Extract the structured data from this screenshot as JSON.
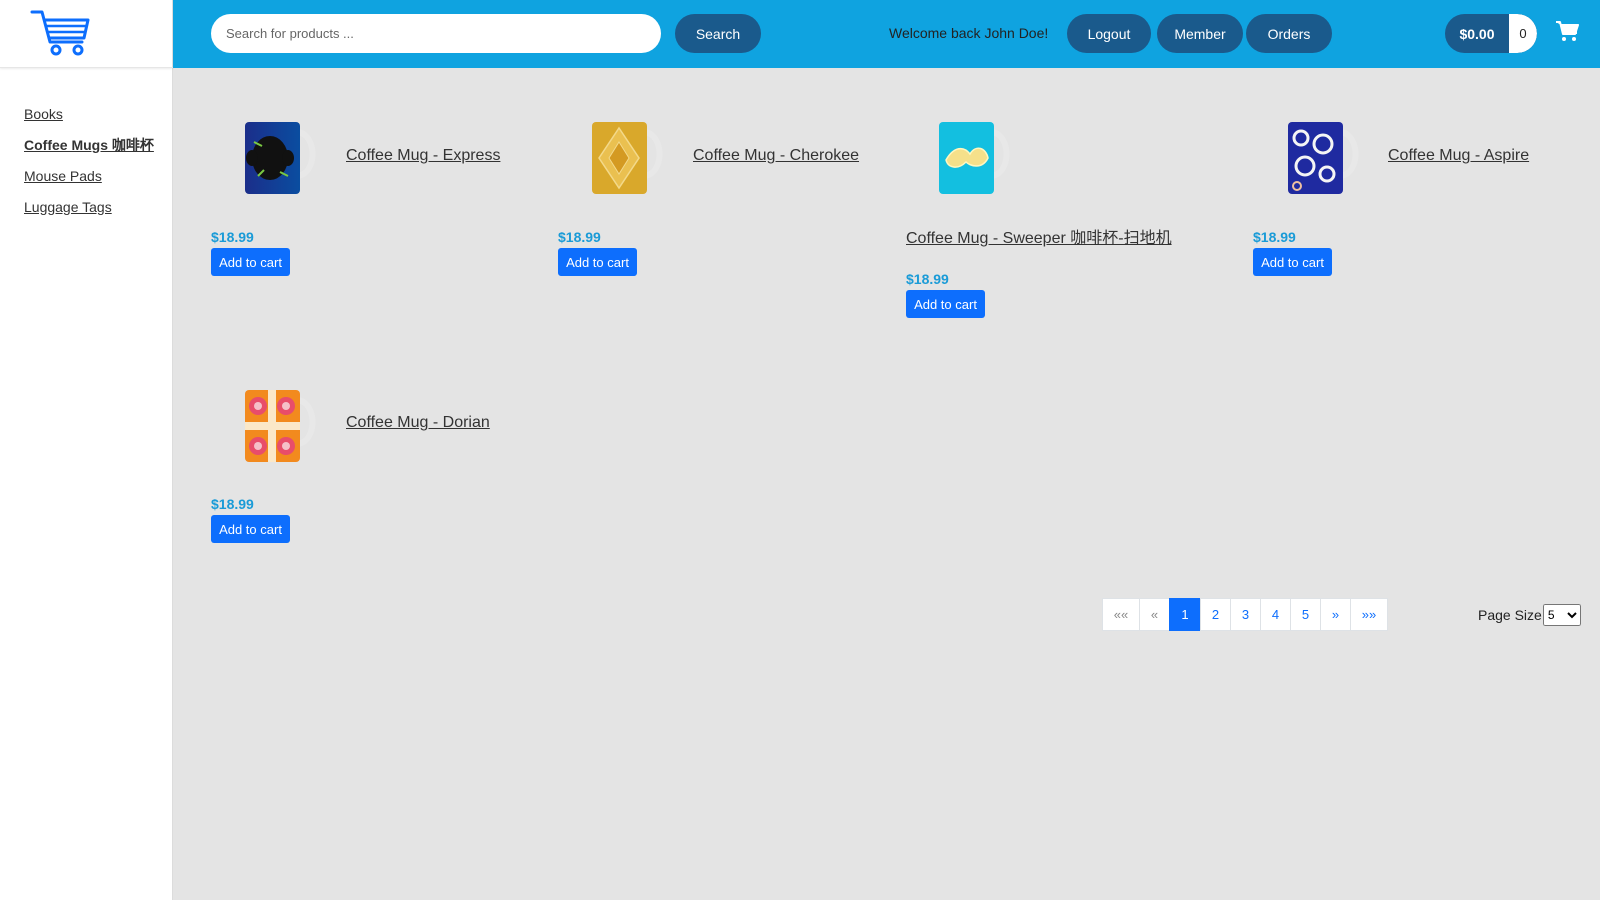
{
  "header": {
    "search_placeholder": "Search for products ...",
    "search_button": "Search",
    "welcome": "Welcome back John Doe!",
    "logout": "Logout",
    "member": "Member",
    "orders": "Orders",
    "cart_total": "$0.00",
    "cart_count": "0"
  },
  "sidebar": {
    "categories": [
      {
        "label": "Books"
      },
      {
        "label": "Coffee Mugs 咖啡杯"
      },
      {
        "label": "Mouse Pads"
      },
      {
        "label": "Luggage Tags"
      }
    ]
  },
  "products": [
    {
      "name": "Coffee Mug - Express",
      "price": "$18.99",
      "button": "Add to cart"
    },
    {
      "name": "Coffee Mug - Cherokee",
      "price": "$18.99",
      "button": "Add to cart"
    },
    {
      "name": "Coffee Mug - Sweeper 咖啡杯-扫地机",
      "price": "$18.99",
      "button": "Add to cart"
    },
    {
      "name": "Coffee Mug - Aspire",
      "price": "$18.99",
      "button": "Add to cart"
    },
    {
      "name": "Coffee Mug - Dorian",
      "price": "$18.99",
      "button": "Add to cart"
    }
  ],
  "pagination": {
    "first": "««",
    "prev": "«",
    "pages": [
      "1",
      "2",
      "3",
      "4",
      "5"
    ],
    "current": "1",
    "next": "»",
    "last": "»»"
  },
  "page_size": {
    "label": "Page Size",
    "value": "5"
  },
  "colors": {
    "header": "#0fa3e0",
    "pill": "#1a5a8c",
    "primary": "#0d6efd",
    "price": "#1a9bd7"
  }
}
